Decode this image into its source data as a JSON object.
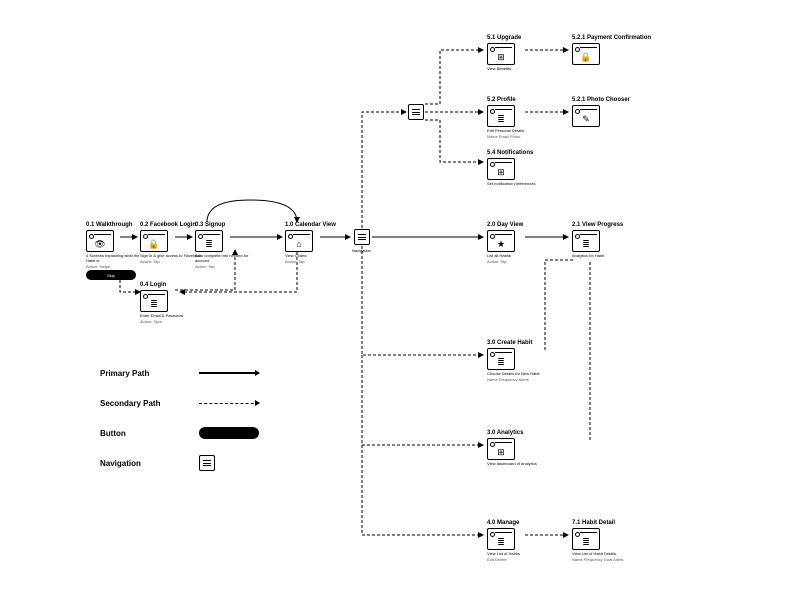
{
  "legend": {
    "primary": "Primary Path",
    "secondary": "Secondary Path",
    "button": "Button",
    "navigation": "Navigation"
  },
  "nodes": {
    "walkthrough": {
      "title": "0.1 Walkthrough",
      "desc": "4 Screens explaining what the Habit is",
      "desc2": "Action: Swipe"
    },
    "fblogin": {
      "title": "0.2 Facebook Login",
      "desc": "Sign in & give access to Facebook",
      "desc2": "Action: Tap"
    },
    "signup": {
      "title": "0.3 Signup",
      "desc": "Auto complete info needed for account",
      "desc2": "Action: Tap"
    },
    "login": {
      "title": "0.4 Login",
      "desc": "Enter Email & Password",
      "desc2": "Action: Type"
    },
    "calendar": {
      "title": "1.0 Calendar View",
      "desc": "View Charts",
      "desc2": "Action: Tap"
    },
    "dayview": {
      "title": "2.0 Day View",
      "desc": "List all Habits",
      "desc2": "Action: Tap"
    },
    "progress": {
      "title": "2.1 View Progress",
      "desc": "Analytics for Habit",
      "desc2": ""
    },
    "create": {
      "title": "3.0 Create Habit",
      "desc": "Choose Details for New Habit",
      "desc2": "Name  Frequency  Alerts"
    },
    "analytics": {
      "title": "3.0 Analytics",
      "desc": "View dashboard of analytics",
      "desc2": ""
    },
    "manage": {
      "title": "4.0 Manage",
      "desc": "View List of Habits",
      "desc2": "Edit  Delete"
    },
    "habitdetail": {
      "title": "7.1 Habit Detail",
      "desc": "View List of Habit Details",
      "desc2": "Name  Frequency  Goal  Alerts"
    },
    "upgrade": {
      "title": "5.1 Upgrade",
      "desc": "View Benefits",
      "desc2": ""
    },
    "profile": {
      "title": "5.2 Profile",
      "desc": "Edit Personal Details",
      "desc2": "Name  Email  Photo"
    },
    "notifications": {
      "title": "5.4 Notifications",
      "desc": "Set notification preferences",
      "desc2": ""
    },
    "payment": {
      "title": "5.2.1 Payment Confirmation",
      "desc": "",
      "desc2": ""
    },
    "photo": {
      "title": "5.2.1 Photo Chooser",
      "desc": "",
      "desc2": ""
    }
  },
  "button": {
    "skip": "Skip"
  },
  "navhub": {
    "label": "Navigation"
  }
}
